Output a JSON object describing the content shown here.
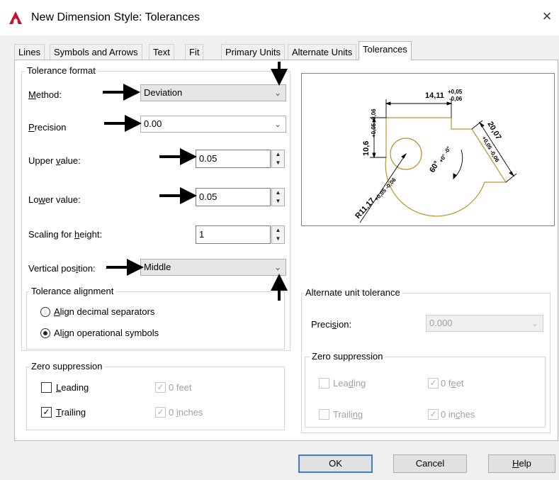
{
  "window": {
    "title": "New Dimension Style: Tolerances",
    "close_symbol": "×"
  },
  "tabs": [
    {
      "label": "Lines"
    },
    {
      "label": "Symbols and Arrows"
    },
    {
      "label": "Text"
    },
    {
      "label": "Fit"
    },
    {
      "label": "Primary Units"
    },
    {
      "label": "Alternate Units"
    },
    {
      "label": "Tolerances",
      "active": true
    }
  ],
  "tolerance_format": {
    "group_label": "Tolerance format",
    "method": {
      "label_pre": "",
      "label_key": "M",
      "label_post": "ethod:",
      "value": "Deviation"
    },
    "precision": {
      "label_key": "P",
      "label_post": "recision",
      "value": "0.00"
    },
    "upper_value": {
      "label_pre": "Upper ",
      "label_key": "v",
      "label_post": "alue:",
      "value": "0.05"
    },
    "lower_value": {
      "label_pre": "Lo",
      "label_key": "w",
      "label_post": "er value:",
      "value": "0.05"
    },
    "scaling": {
      "label_pre": "Scaling for ",
      "label_key": "h",
      "label_post": "eight:",
      "value": "1"
    },
    "vertical_position": {
      "label_pre": "Vertical pos",
      "label_key": "i",
      "label_post": "tion:",
      "value": "Middle"
    }
  },
  "tolerance_alignment": {
    "group_label": "Tolerance alignment",
    "option1": {
      "pre": "",
      "key": "A",
      "post": "lign decimal separators",
      "selected": false
    },
    "option2": {
      "pre": "Al",
      "key": "i",
      "post": "gn operational symbols",
      "selected": true
    }
  },
  "zero_suppression_left": {
    "group_label": "Zero suppression",
    "leading": {
      "key": "L",
      "post": "eading",
      "checked": false
    },
    "trailing": {
      "key": "T",
      "post": "railing",
      "checked": true
    },
    "feet": {
      "text": "0 feet",
      "checked": true,
      "disabled": true
    },
    "inches": {
      "pre": "0 ",
      "key": "i",
      "post": "nches",
      "checked": true,
      "disabled": true
    }
  },
  "alternate_unit_tolerance": {
    "group_label": "Alternate unit tolerance",
    "precision": {
      "pre": "Preci",
      "key": "s",
      "post": "ion:",
      "value": "0.000"
    }
  },
  "zero_suppression_right": {
    "group_label": "Zero suppression",
    "leading": {
      "pre": "Lea",
      "key": "d",
      "post": "ing",
      "checked": false
    },
    "trailing": {
      "pre": "Traili",
      "key": "n",
      "post": "g",
      "checked": false
    },
    "feet": {
      "pre": "0 f",
      "key": "e",
      "post": "et",
      "checked": true
    },
    "inches": {
      "pre": "0 in",
      "key": "c",
      "post": "hes",
      "checked": true
    }
  },
  "preview": {
    "dim_top": "14,11",
    "dim_top_plus": "+0,05",
    "dim_top_minus": "-0,06",
    "dim_left": "10,6",
    "dim_left_tol": "+0,05 -0,06",
    "dim_right": "20,07",
    "dim_right_tol": "+0,05 -0,06",
    "dim_angle": "60°",
    "dim_angle_tol": "+0° -0°",
    "dim_radius": "R11,17",
    "dim_radius_tol": "+0,05 -0,06"
  },
  "buttons": {
    "ok": "OK",
    "cancel": "Cancel",
    "help_key": "H",
    "help_post": "elp"
  },
  "colors": {
    "accent": "#3c7fd6",
    "part_outline": "#b8962e"
  }
}
